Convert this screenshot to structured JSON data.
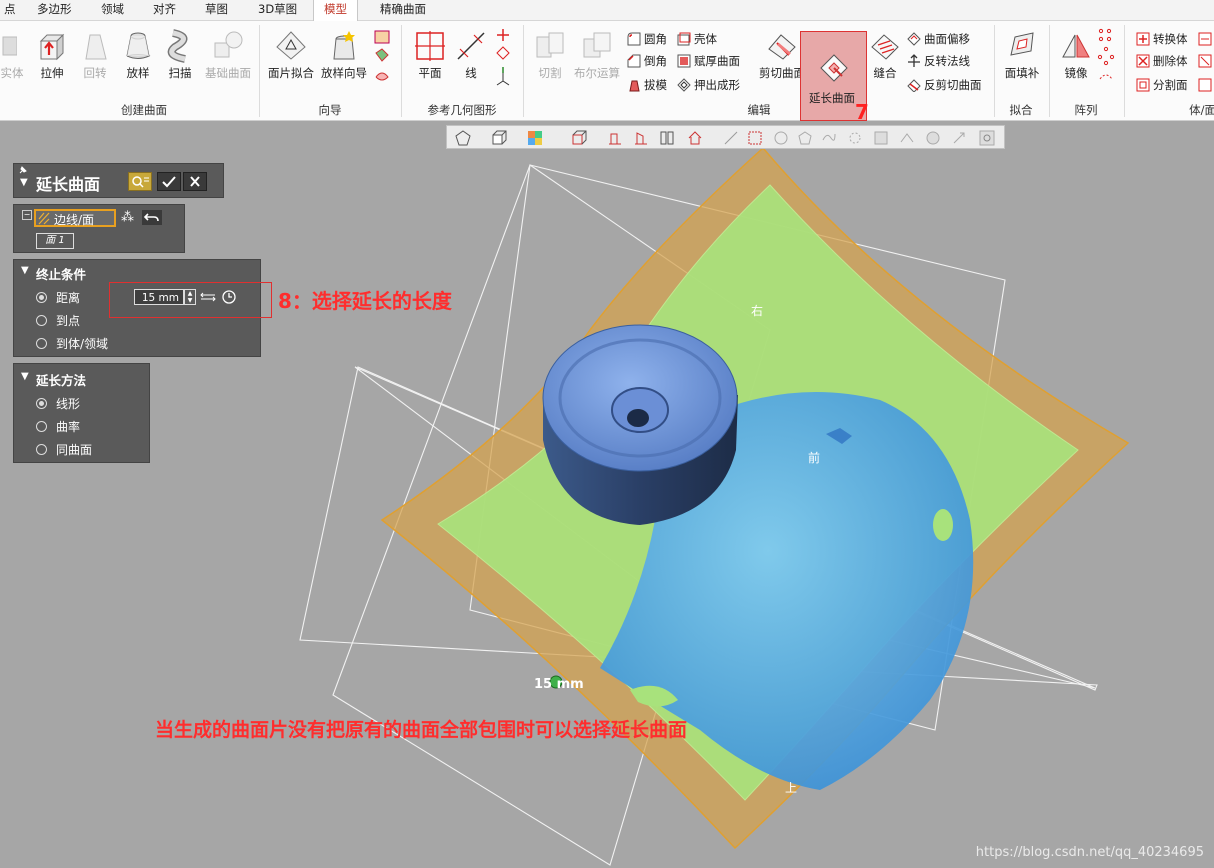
{
  "tabs": [
    "点",
    "多边形",
    "领域",
    "对齐",
    "草图",
    "3D草图",
    "模型",
    "精确曲面"
  ],
  "active_tab_index": 6,
  "ribbon": {
    "groups": {
      "create_surface": "创建曲面",
      "wizard": "向导",
      "ref_geometry": "参考几何图形",
      "edit": "编辑",
      "fit": "拟合",
      "array": "阵列",
      "body_face": "体/面"
    },
    "buttons": {
      "entity_partial": "实体",
      "extrude": "拉伸",
      "revolve": "回转",
      "loft": "放样",
      "sweep": "扫描",
      "base_surface": "基础曲面",
      "patch_fit": "面片拟合",
      "loft_wizard": "放样向导",
      "plane": "平面",
      "line": "线",
      "cut": "切割",
      "boolean": "布尔运算",
      "fillet": "圆角",
      "chamfer": "倒角",
      "draft": "拔模",
      "shell": "壳体",
      "thicken": "赋厚曲面",
      "extrude_form": "押出成形",
      "trim_surface": "剪切曲面",
      "extend_surface": "延长曲面",
      "sew": "缝合",
      "offset_surface": "曲面偏移",
      "reverse_normal": "反转法线",
      "untrim_surface": "反剪切曲面",
      "face_fill": "面填补",
      "mirror": "镜像",
      "convert_body": "转换体",
      "delete_body": "删除体",
      "split_face": "分割面"
    }
  },
  "panel_extend": {
    "title": "延长曲面",
    "edge_face_label": "边线/面",
    "face_item": "面 1"
  },
  "panel_end": {
    "title": "终止条件",
    "options": [
      "距离",
      "到点",
      "到体/领域"
    ],
    "selected": 0,
    "distance_value": "15 mm"
  },
  "panel_method": {
    "title": "延长方法",
    "options": [
      "线形",
      "曲率",
      "同曲面"
    ],
    "selected": 0
  },
  "viewport": {
    "labels": {
      "right": "右",
      "front": "前",
      "top": "上"
    },
    "dimension": "15 mm"
  },
  "annotations": {
    "step7": "7",
    "step8": "8：选择延长的长度",
    "note": "当生成的曲面片没有把原有的曲面全部包围时可以选择延长曲面"
  },
  "watermark": "https://blog.csdn.net/qq_40234695",
  "colors": {
    "accent_red": "#e03030",
    "orange_surface": "#d9a24a",
    "green_surface": "#a6e07a",
    "blue_mesh": "#5ab4f0"
  }
}
